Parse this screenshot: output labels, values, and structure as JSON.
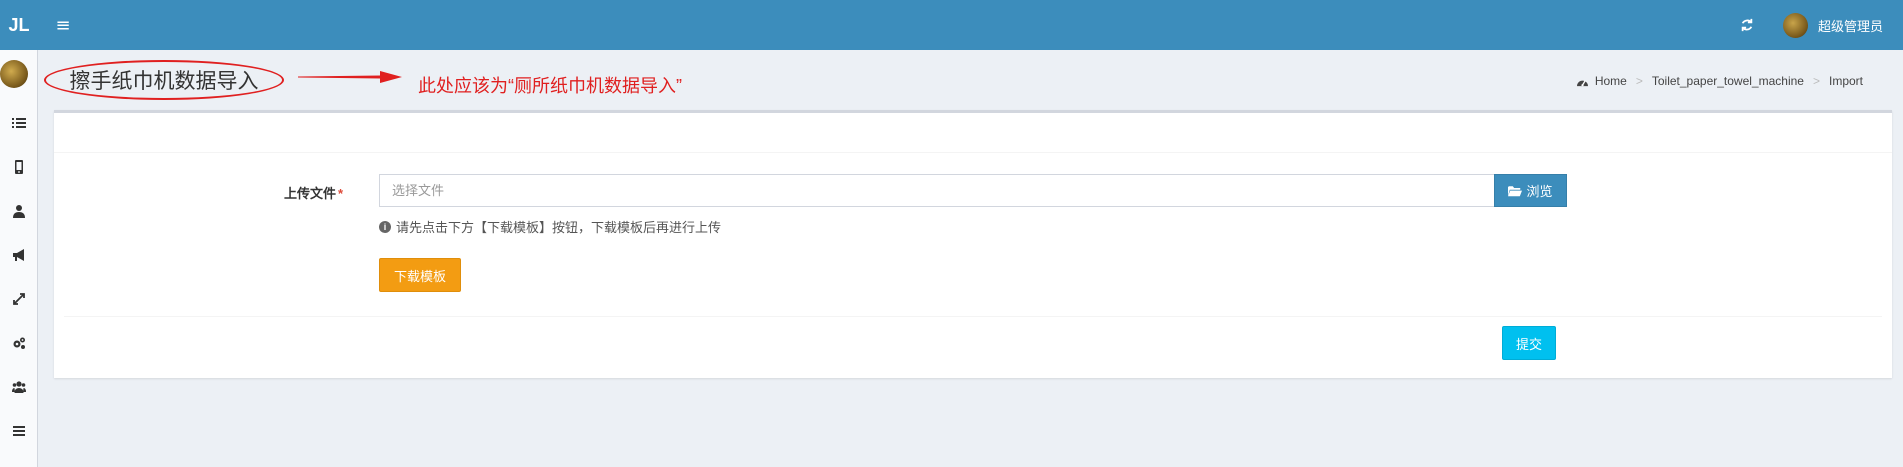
{
  "topbar": {
    "logo": "JL",
    "menu_icon": "hamburger-icon",
    "refresh_icon": "refresh-icon",
    "user_name": "超级管理员",
    "bg_color": "#3c8dbc"
  },
  "sidebar": {
    "icons": [
      "list-icon",
      "mobile-icon",
      "user-icon",
      "bullhorn-icon",
      "expand-icon",
      "cogs-icon",
      "users-icon",
      "bars-icon"
    ]
  },
  "header": {
    "page_title": "擦手纸巾机数据导入",
    "annotation_note": "此处应该为“厕所纸巾机数据导入”",
    "annotation_color": "#e02020"
  },
  "breadcrumb": {
    "items": [
      "Home",
      "Toilet_paper_towel_machine",
      "Import"
    ]
  },
  "form": {
    "upload_label": "上传文件",
    "required_mark": "*",
    "file_placeholder": "选择文件",
    "browse_label": "浏览",
    "help_text": "请先点击下方【下载模板】按钮，下载模板后再进行上传",
    "download_label": "下载模板",
    "submit_label": "提交",
    "download_color": "#f39c12",
    "submit_color": "#00c0ef"
  }
}
